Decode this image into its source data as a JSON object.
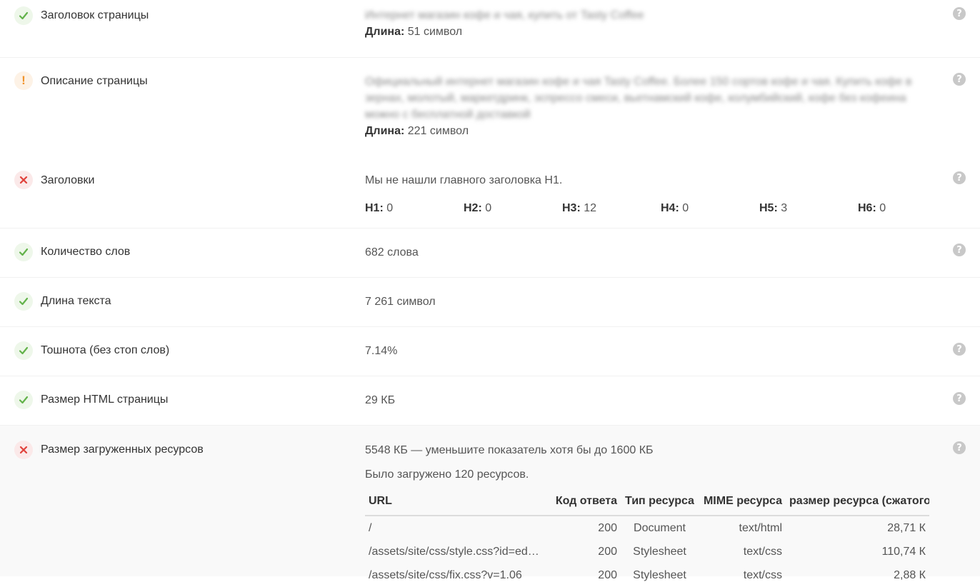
{
  "rows": [
    {
      "label": "Заголовок страницы",
      "status": "ok",
      "value_blurred": "Интернет магазин кофе и чая, купить от Tasty Coffee",
      "length_label": "Длина:",
      "length_value": "51 символ"
    },
    {
      "label": "Описание страницы",
      "status": "warning",
      "value_blurred": "Официальный интернет магазин кофе и чая Tasty Coffee. Более 150 сортов кофе и чая. Купить кофе в зернах, молотый, маркетдринк, эспрессо смеси, вьетнамский кофе, колумбийский, кофе без кофеина можно с бесплатной доставкой",
      "length_label": "Длина:",
      "length_value": "221 символ"
    },
    {
      "label": "Заголовки",
      "status": "error",
      "message": "Мы не нашли главного заголовка H1.",
      "headings": [
        {
          "tag": "H1:",
          "count": "0"
        },
        {
          "tag": "H2:",
          "count": "0"
        },
        {
          "tag": "H3:",
          "count": "12"
        },
        {
          "tag": "H4:",
          "count": "0"
        },
        {
          "tag": "H5:",
          "count": "3"
        },
        {
          "tag": "H6:",
          "count": "0"
        }
      ]
    },
    {
      "label": "Количество слов",
      "status": "ok",
      "value": "682 слова"
    },
    {
      "label": "Длина текста",
      "status": "ok",
      "value": "7 261 символ"
    },
    {
      "label": "Тошнота (без стоп слов)",
      "status": "ok",
      "value": "7.14%"
    },
    {
      "label": "Размер HTML страницы",
      "status": "ok",
      "value": "29 КБ"
    },
    {
      "label": "Размер загруженных ресурсов",
      "status": "error",
      "value": "5548 КБ — уменьшите показатель хотя бы до 1600 КБ",
      "note": "Было загружено 120 ресурсов.",
      "table": {
        "columns": [
          "URL",
          "Код ответа",
          "Тип ресурса",
          "MIME ресурса",
          "размер ресурса (сжатого"
        ],
        "rows": [
          [
            "/",
            "200",
            "Document",
            "text/html",
            "28,71 К"
          ],
          [
            "/assets/site/css/style.css?id=ed…",
            "200",
            "Stylesheet",
            "text/css",
            "110,74 К"
          ],
          [
            "/assets/site/css/fix.css?v=1.06",
            "200",
            "Stylesheet",
            "text/css",
            "2,88 К"
          ]
        ]
      }
    }
  ],
  "help_icon": "?",
  "colors": {
    "ok": "#62b24a",
    "warning": "#f0932b",
    "error": "#e0413a"
  }
}
